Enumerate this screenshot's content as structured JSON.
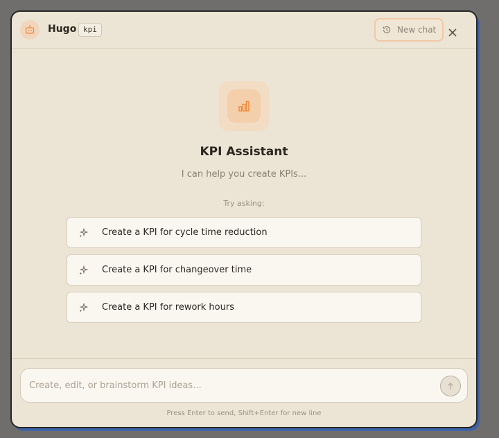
{
  "header": {
    "assistant_name": "Hugo",
    "mode_badge": "kpi",
    "new_chat_label": "New chat",
    "close_icon": "close-icon",
    "avatar_icon": "robot-icon"
  },
  "hero": {
    "icon": "bar-chart-icon",
    "title": "KPI Assistant",
    "subtitle": "I can help you create KPIs...",
    "try_label": "Try asking:"
  },
  "suggestions": [
    {
      "label": "Create a KPI for cycle time reduction"
    },
    {
      "label": "Create a KPI for changeover time"
    },
    {
      "label": "Create a KPI for rework hours"
    }
  ],
  "composer": {
    "placeholder": "Create, edit, or brainstorm KPI ideas...",
    "value": "",
    "send_icon": "arrow-up-icon",
    "hint": "Press Enter to send, Shift+Enter for new line"
  },
  "colors": {
    "accent": "#f08a3c",
    "panel_bg": "#ece4d4",
    "card_bg": "#faf7f1"
  }
}
